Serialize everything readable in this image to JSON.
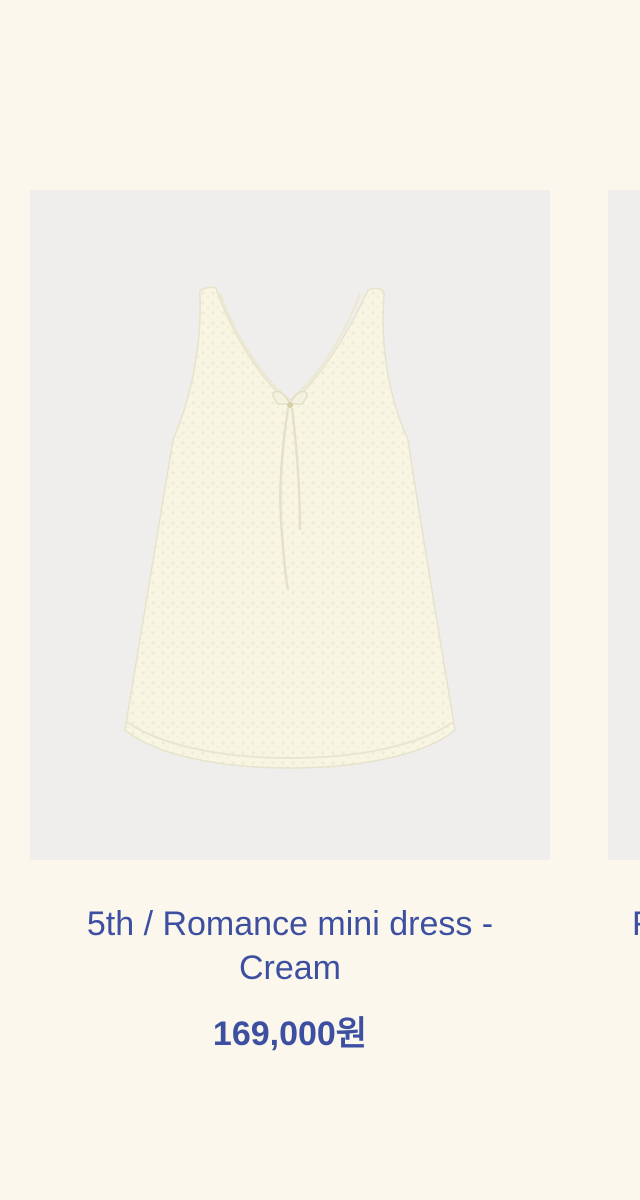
{
  "products": [
    {
      "name": "5th / Romance mini dress - Cream",
      "price": "169,000원",
      "image": "cream-sleeveless-mini-dress"
    },
    {
      "name": "F",
      "price": "",
      "image": "next-product-image"
    }
  ],
  "colors": {
    "background": "#fbf7ec",
    "image_background": "#efeeec",
    "text_accent": "#3d4fa0",
    "dress_fabric": "#f8f6e4"
  }
}
